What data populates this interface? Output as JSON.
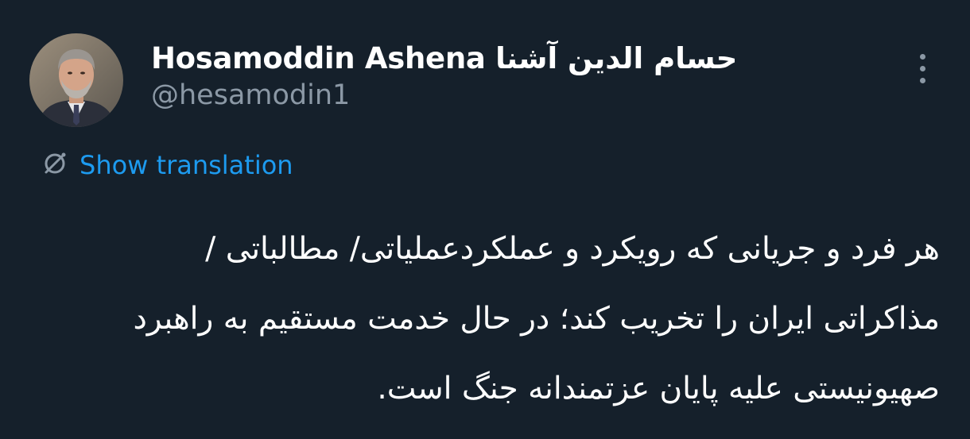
{
  "author": {
    "display_name": "Hosamoddin Ashena حسام الدین آشنا",
    "handle": "@hesamodin1"
  },
  "translation": {
    "label": "Show translation"
  },
  "tweet": {
    "lines": [
      "هر فرد و جریانی که رویکرد و عملکردعملیاتی/ مطالباتی /",
      "مذاکراتی ایران را تخریب کند؛ در حال خدمت مستقیم به راهبرد",
      "صهیونیستی علیه پایان عزتمندانه جنگ است."
    ]
  },
  "icons": {
    "more": "more-vertical-icon",
    "translate": "translate-icon"
  },
  "colors": {
    "background": "#15202b",
    "text_primary": "#ffffff",
    "text_secondary": "#8b98a5",
    "link": "#1d9bf0"
  }
}
